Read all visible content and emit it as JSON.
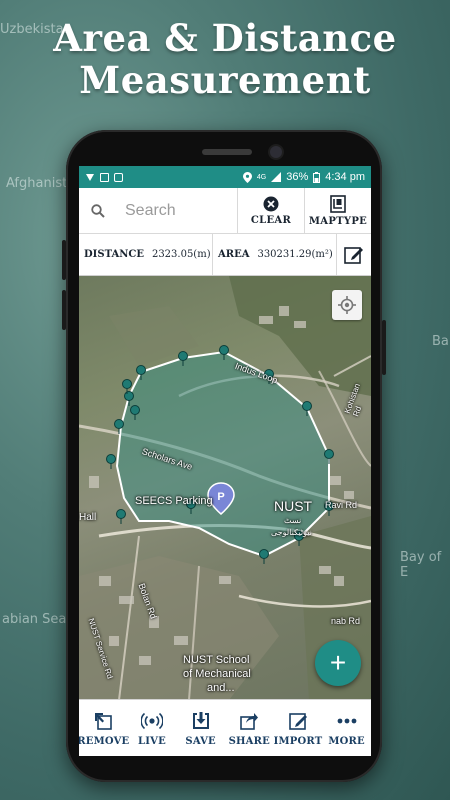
{
  "banner": {
    "title_line1": "Area & Distance",
    "title_line2": "Measurement"
  },
  "background_labels": {
    "top_left": "Uzbekistan",
    "left": "Afghanistan",
    "bottom_left": "abian Sea",
    "right_ba": "Ba",
    "right_bay": "Bay of E"
  },
  "status_bar": {
    "network": "4G",
    "battery": "36%",
    "time": "4:34 pm"
  },
  "search": {
    "placeholder": "Search"
  },
  "toolbar": {
    "clear_label": "CLEAR",
    "map_type_label": "MAPTYPE"
  },
  "metrics": {
    "distance_label": "DISTANCE",
    "distance_value": "2323.05(m)",
    "area_label": "AREA",
    "area_value": "330231.29(m²)"
  },
  "map": {
    "roads": {
      "indus_loop": "Indus Loop",
      "scholars_ave": "Scholars Ave",
      "ravi_rd": "Ravi Rd",
      "chenab_rd": "nab Rd",
      "bolan_rd": "Bolan Rd",
      "nust_service_rd": "NUST Service Rd",
      "kohistan_rd": "Kohistan Rd"
    },
    "places": {
      "sefcs_parking": "SEECS Parking",
      "nust": "NUST",
      "nust_urdu_line1": "نسٹ",
      "nust_urdu_line2": "نیوٹیکنالوجی",
      "hall": "Hall",
      "school_line1": "NUST School",
      "school_line2": "of Mechanical",
      "school_line3": "and..."
    },
    "fab_symbol": "+",
    "polygon_fill": "#2e8f85",
    "marker_color": "#1f7a73"
  },
  "bottom_nav": [
    {
      "label": "REMOVE",
      "icon": "undo-icon"
    },
    {
      "label": "LIVE",
      "icon": "broadcast-icon"
    },
    {
      "label": "SAVE",
      "icon": "download-icon"
    },
    {
      "label": "SHARE",
      "icon": "share-icon"
    },
    {
      "label": "IMPORT",
      "icon": "import-icon"
    },
    {
      "label": "MORE",
      "icon": "more-icon"
    }
  ],
  "colors": {
    "accent": "#1f8d86",
    "nav_label": "#1b3f63"
  }
}
